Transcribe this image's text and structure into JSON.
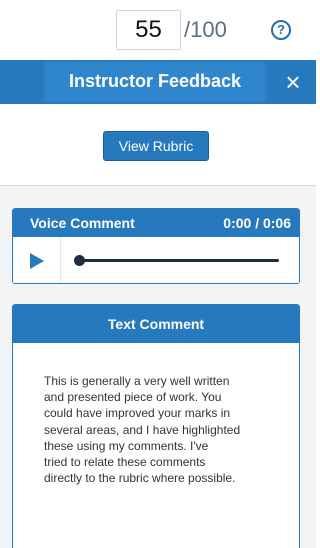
{
  "grade": {
    "score": "55",
    "max": "/100",
    "help_icon": "?"
  },
  "header": {
    "title": "Instructor Feedback",
    "close_icon": "×"
  },
  "rubric": {
    "button_label": "View Rubric"
  },
  "voice": {
    "title": "Voice Comment",
    "time": "0:00 / 0:06"
  },
  "text_comment": {
    "title": "Text Comment",
    "body": "This is generally a very well written\nand presented piece of work.  You\ncould have improved your marks in\nseveral areas, and I have highlighted\nthese using my comments.  I've\ntried to relate these comments\ndirectly to the rubric where possible."
  }
}
